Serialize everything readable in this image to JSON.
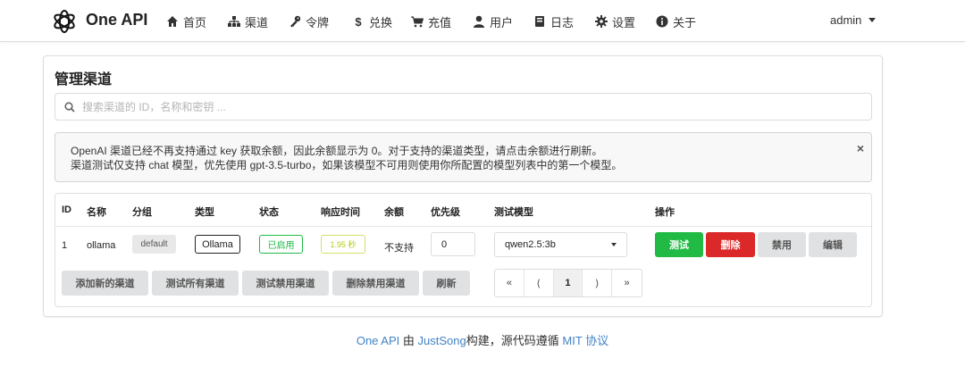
{
  "app": {
    "brand": "One API"
  },
  "nav": [
    {
      "label": "首页",
      "icon": "home-icon"
    },
    {
      "label": "渠道",
      "icon": "sitemap-icon"
    },
    {
      "label": "令牌",
      "icon": "key-icon"
    },
    {
      "label": "兑换",
      "icon": "dollar-icon"
    },
    {
      "label": "充值",
      "icon": "cart-icon"
    },
    {
      "label": "用户",
      "icon": "user-icon"
    },
    {
      "label": "日志",
      "icon": "book-icon"
    },
    {
      "label": "设置",
      "icon": "gear-icon"
    },
    {
      "label": "关于",
      "icon": "info-circle-icon"
    }
  ],
  "user": {
    "name": "admin"
  },
  "page": {
    "title": "管理渠道"
  },
  "search": {
    "placeholder": "搜索渠道的 ID，名称和密钥 ..."
  },
  "notice": {
    "line1": "OpenAI 渠道已经不再支持通过 key 获取余额，因此余额显示为 0。对于支持的渠道类型，请点击余额进行刷新。",
    "line2": "渠道测试仅支持 chat 模型，优先使用 gpt-3.5-turbo，如果该模型不可用则使用你所配置的模型列表中的第一个模型。",
    "close": "×"
  },
  "table": {
    "headers": [
      "ID",
      "名称",
      "分组",
      "类型",
      "状态",
      "响应时间",
      "余额",
      "优先级",
      "测试模型",
      "操作"
    ],
    "rows": [
      {
        "id": "1",
        "name": "ollama",
        "group": "default",
        "type": "Ollama",
        "status": "已启用",
        "response_time": "1.95 秒",
        "balance": "不支持",
        "priority": "0",
        "test_model": "qwen2.5:3b",
        "actions": {
          "test": "测试",
          "delete": "删除",
          "disable": "禁用",
          "edit": "编辑"
        }
      }
    ]
  },
  "toolbar": {
    "add": "添加新的渠道",
    "test_all": "测试所有渠道",
    "test_disabled": "测试禁用渠道",
    "delete_disabled": "删除禁用渠道",
    "refresh": "刷新"
  },
  "pagination": {
    "first": "«",
    "prev": "⟨",
    "current": "1",
    "next": "⟩",
    "last": "»"
  },
  "footer": {
    "app": "One API",
    "by": "由",
    "author": "JustSong",
    "built": "构建，源代码遵循",
    "license": "MIT 协议"
  },
  "colors": {
    "green": "#21ba45",
    "red": "#db2828",
    "link": "#4183c4",
    "olive": "#b5cc18"
  }
}
